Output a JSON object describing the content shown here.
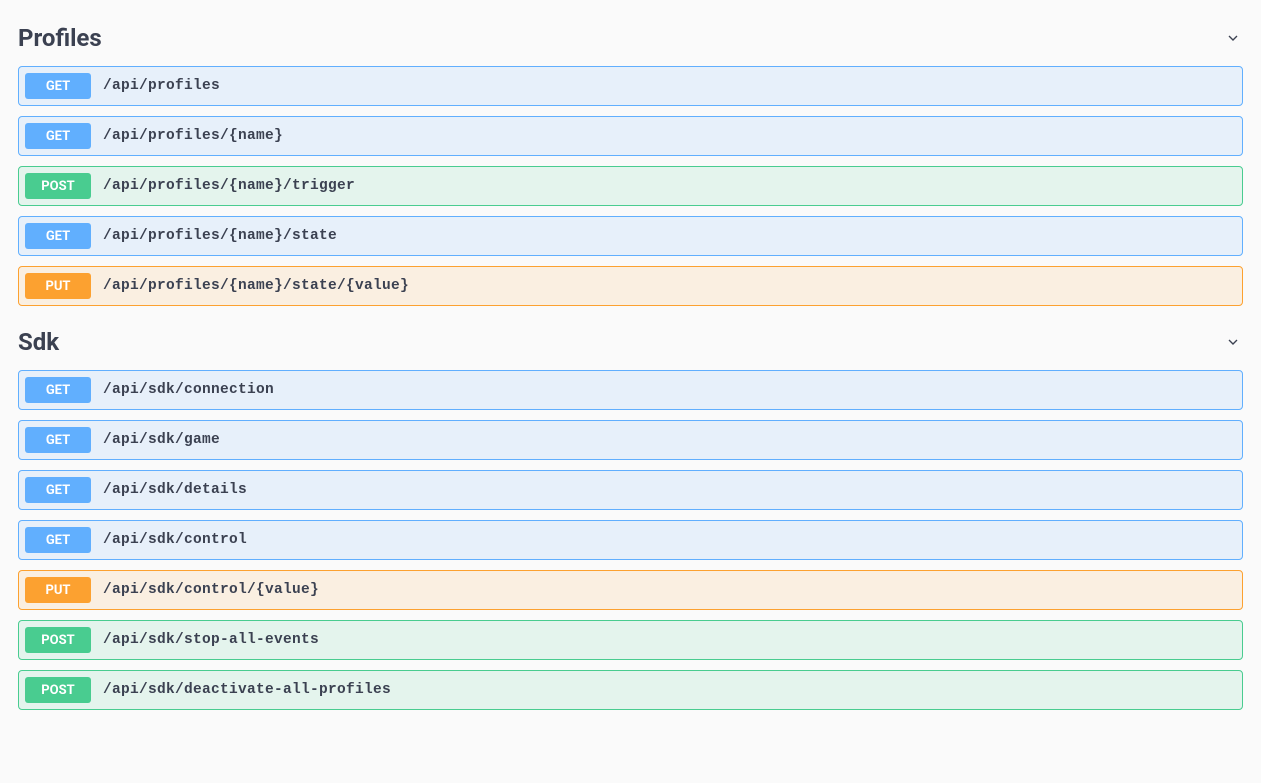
{
  "sections": [
    {
      "title": "Profiles",
      "endpoints": [
        {
          "method": "GET",
          "path": "/api/profiles"
        },
        {
          "method": "GET",
          "path": "/api/profiles/{name}"
        },
        {
          "method": "POST",
          "path": "/api/profiles/{name}/trigger"
        },
        {
          "method": "GET",
          "path": "/api/profiles/{name}/state"
        },
        {
          "method": "PUT",
          "path": "/api/profiles/{name}/state/{value}"
        }
      ]
    },
    {
      "title": "Sdk",
      "endpoints": [
        {
          "method": "GET",
          "path": "/api/sdk/connection"
        },
        {
          "method": "GET",
          "path": "/api/sdk/game"
        },
        {
          "method": "GET",
          "path": "/api/sdk/details"
        },
        {
          "method": "GET",
          "path": "/api/sdk/control"
        },
        {
          "method": "PUT",
          "path": "/api/sdk/control/{value}"
        },
        {
          "method": "POST",
          "path": "/api/sdk/stop-all-events"
        },
        {
          "method": "POST",
          "path": "/api/sdk/deactivate-all-profiles"
        }
      ]
    }
  ]
}
